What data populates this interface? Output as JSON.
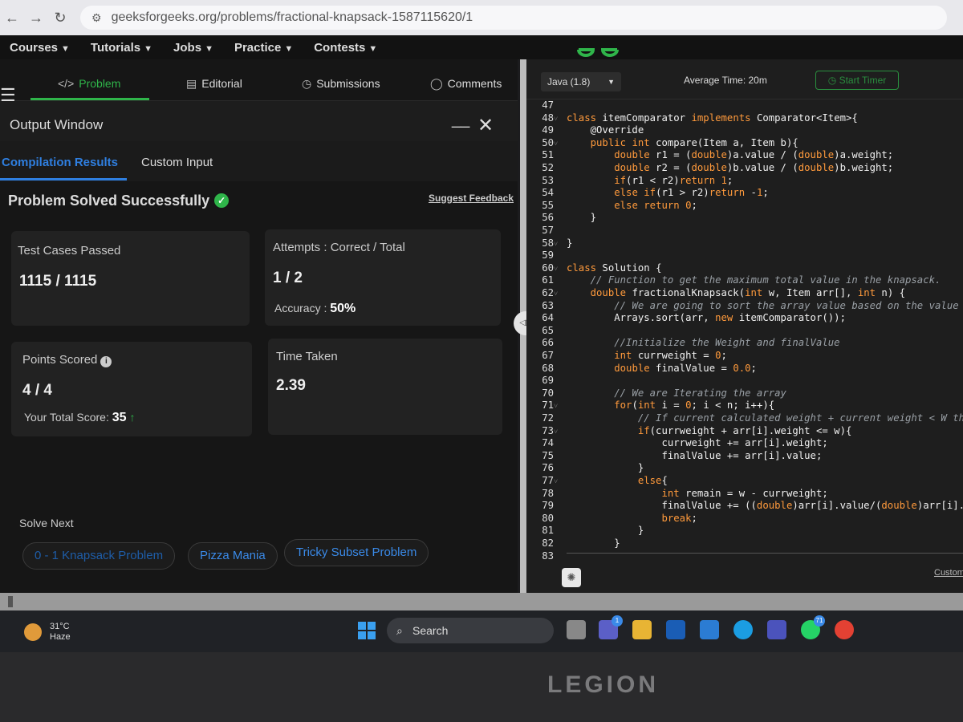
{
  "browser": {
    "url": "geeksforgeeks.org/problems/fractional-knapsack-1587115620/1"
  },
  "site_nav": {
    "items": [
      "Courses",
      "Tutorials",
      "Jobs",
      "Practice",
      "Contests"
    ]
  },
  "problem_tabs": {
    "problem": "Problem",
    "editorial": "Editorial",
    "submissions": "Submissions",
    "comments": "Comments"
  },
  "output_window": {
    "title": "Output Window",
    "tabs": [
      "Compilation Results",
      "Custom Input"
    ],
    "status": "Problem Solved Successfully",
    "feedback": "Suggest Feedback",
    "cards": {
      "test_cases_label": "Test Cases Passed",
      "test_cases_value": "1115 / 1115",
      "attempts_label": "Attempts : Correct / Total",
      "attempts_value": "1 / 2",
      "accuracy_label": "Accuracy :",
      "accuracy_value": "50%",
      "points_label": "Points Scored",
      "points_value": "4 / 4",
      "total_score_label": "Your Total Score:",
      "total_score_value": "35",
      "time_label": "Time Taken",
      "time_value": "2.39"
    },
    "solve_next_label": "Solve Next",
    "solve_next": [
      "0 - 1 Knapsack Problem",
      "Pizza Mania",
      "Tricky Subset Problem"
    ]
  },
  "editor": {
    "language": "Java (1.8)",
    "average_time": "Average Time: 20m",
    "timer": "Start Timer",
    "custom_link": "Custom",
    "code_lines": [
      {
        "n": "47",
        "t": ""
      },
      {
        "n": "48",
        "t": "class itemComparator implements Comparator<Item>{"
      },
      {
        "n": "49",
        "t": "    @Override"
      },
      {
        "n": "50",
        "t": "    public int compare(Item a, Item b){"
      },
      {
        "n": "51",
        "t": "        double r1 = (double)a.value / (double)a.weight;"
      },
      {
        "n": "52",
        "t": "        double r2 = (double)b.value / (double)b.weight;"
      },
      {
        "n": "53",
        "t": "        if(r1 < r2)return 1;"
      },
      {
        "n": "54",
        "t": "        else if(r1 > r2)return -1;"
      },
      {
        "n": "55",
        "t": "        else return 0;"
      },
      {
        "n": "56",
        "t": "    }"
      },
      {
        "n": "57",
        "t": ""
      },
      {
        "n": "58",
        "t": "}"
      },
      {
        "n": "59",
        "t": ""
      },
      {
        "n": "60",
        "t": "class Solution {"
      },
      {
        "n": "61",
        "t": "    // Function to get the maximum total value in the knapsack."
      },
      {
        "n": "62",
        "t": "    double fractionalKnapsack(int w, Item arr[], int n) {"
      },
      {
        "n": "63",
        "t": "        // We are going to sort the array value based on the value"
      },
      {
        "n": "64",
        "t": "        Arrays.sort(arr, new itemComparator());"
      },
      {
        "n": "65",
        "t": ""
      },
      {
        "n": "66",
        "t": "        //Initialize the Weight and finalValue"
      },
      {
        "n": "67",
        "t": "        int currweight = 0;"
      },
      {
        "n": "68",
        "t": "        double finalValue = 0.0;"
      },
      {
        "n": "69",
        "t": ""
      },
      {
        "n": "70",
        "t": "        // We are Iterating the array"
      },
      {
        "n": "71",
        "t": "        for(int i = 0; i < n; i++){"
      },
      {
        "n": "72",
        "t": "            // If current calculated weight + current weight < W th"
      },
      {
        "n": "73",
        "t": "            if(currweight + arr[i].weight <= w){"
      },
      {
        "n": "74",
        "t": "                currweight += arr[i].weight;"
      },
      {
        "n": "75",
        "t": "                finalValue += arr[i].value;"
      },
      {
        "n": "76",
        "t": "            }"
      },
      {
        "n": "77",
        "t": "            else{"
      },
      {
        "n": "78",
        "t": "                int remain = w - currweight;"
      },
      {
        "n": "79",
        "t": "                finalValue += ((double)arr[i].value/(double)arr[i]."
      },
      {
        "n": "80",
        "t": "                break;"
      },
      {
        "n": "81",
        "t": "            }"
      },
      {
        "n": "82",
        "t": "        }"
      },
      {
        "n": "83",
        "t": ""
      }
    ],
    "fold_lines": [
      "48",
      "50",
      "58",
      "60",
      "62",
      "71",
      "73",
      "77"
    ]
  },
  "taskbar": {
    "temperature": "31°C",
    "weather": "Haze",
    "search": "Search",
    "teams_badge": "1",
    "whatsapp_badge": "71"
  },
  "laptop_brand": "LEGION",
  "colors": {
    "gfg_green": "#2fb54a",
    "link_blue": "#2f7fe0",
    "keyword": "#ff9a3c",
    "comment": "#9aa0a6"
  }
}
